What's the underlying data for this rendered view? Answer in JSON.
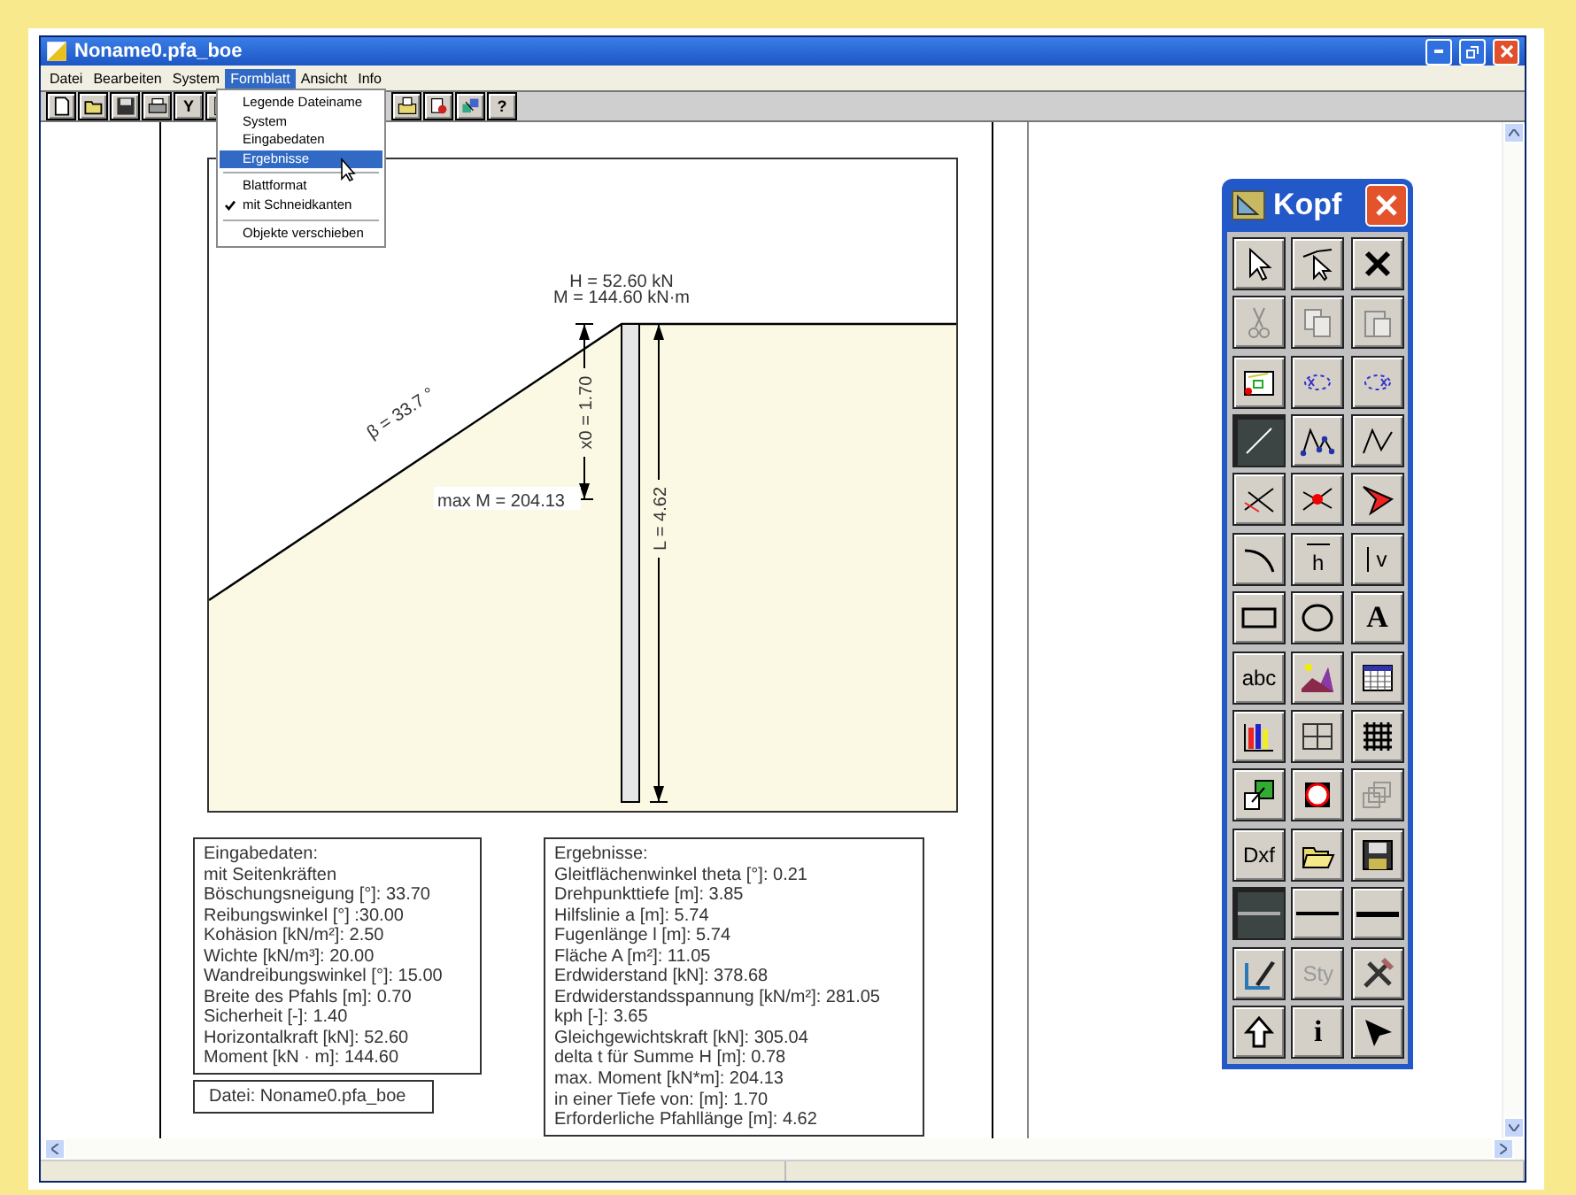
{
  "window": {
    "title": "Noname0.pfa_boe"
  },
  "menu": [
    {
      "label": "Datei",
      "selected": false
    },
    {
      "label": "Bearbeiten",
      "selected": false
    },
    {
      "label": "System",
      "selected": false
    },
    {
      "label": "Formblatt",
      "selected": true
    },
    {
      "label": "Ansicht",
      "selected": false
    },
    {
      "label": "Info",
      "selected": false
    }
  ],
  "dropdown": [
    {
      "kind": "item",
      "label": "Legende Dateiname",
      "checked": false,
      "selected": false
    },
    {
      "kind": "item",
      "label": "System",
      "checked": false,
      "selected": false
    },
    {
      "kind": "item",
      "label": "Eingabedaten",
      "checked": false,
      "selected": false
    },
    {
      "kind": "item",
      "label": "Ergebnisse",
      "checked": false,
      "selected": true
    },
    {
      "kind": "separator"
    },
    {
      "kind": "item",
      "label": "Blattformat",
      "checked": false,
      "selected": false
    },
    {
      "kind": "item",
      "label": "mit Schneidkanten",
      "checked": true,
      "selected": false
    },
    {
      "kind": "separator"
    },
    {
      "kind": "item",
      "label": "Objekte verschieben",
      "checked": false,
      "selected": false
    }
  ],
  "toolbar": {
    "left": [
      {
        "kind": "icon"
      },
      {
        "kind": "icon"
      },
      {
        "kind": "icon"
      },
      {
        "kind": "icon"
      },
      {
        "kind": "text",
        "label": "Y"
      },
      {
        "kind": "icon"
      }
    ],
    "right": [
      {
        "kind": "icon"
      },
      {
        "kind": "icon"
      },
      {
        "kind": "icon"
      },
      {
        "kind": "text",
        "label": "?"
      }
    ]
  },
  "diagram": {
    "force": "H = 52.60 kN",
    "moment": "M = 144.60 kN·m",
    "angle": "β = 33.7 °",
    "x0": "x0 = 1.70",
    "max_moment": "max M = 204.13",
    "length": "L = 4.62"
  },
  "input_box": {
    "lines": [
      "Eingabedaten:",
      "mit Seitenkräften",
      "Böschungsneigung [°]: 33.70",
      "Reibungswinkel [°] :30.00",
      "Kohäsion [kN/m²]: 2.50",
      "Wichte [kN/m³]: 20.00",
      "Wandreibungswinkel [°]: 15.00",
      "Breite des Pfahls [m]: 0.70",
      "Sicherheit [-]: 1.40",
      "Horizontalkraft [kN]: 52.60",
      "Moment [kN · m]: 144.60"
    ]
  },
  "file_box": {
    "text": "Datei: Noname0.pfa_boe"
  },
  "results_box": {
    "lines": [
      "Ergebnisse:",
      "Gleitflächenwinkel theta [°]: 0.21",
      "Drehpunkttiefe [m]: 3.85",
      "Hilfslinie a [m]: 5.74",
      "Fugenlänge l [m]: 5.74",
      "Fläche A [m²]: 11.05",
      "Erdwiderstand [kN]: 378.68",
      "Erdwiderstandsspannung [kN/m²]: 281.05",
      "kph [-]: 3.65",
      "Gleichgewichtskraft [kN]: 305.04",
      "delta t für Summe H [m]: 0.78",
      "max. Moment [kN*m]: 204.13",
      "in einer Tiefe von: [m]: 1.70",
      "Erforderliche Pfahllänge [m]: 4.62"
    ]
  },
  "palette": {
    "title": "Kopf",
    "buttons": [
      {
        "kind": "icon",
        "disabled": false,
        "pressed": false
      },
      {
        "kind": "icon",
        "disabled": false,
        "pressed": false
      },
      {
        "kind": "icon",
        "disabled": false,
        "pressed": false
      },
      {
        "kind": "icon",
        "disabled": true,
        "pressed": false
      },
      {
        "kind": "icon",
        "disabled": true,
        "pressed": false
      },
      {
        "kind": "icon",
        "disabled": true,
        "pressed": false
      },
      {
        "kind": "icon",
        "disabled": false,
        "pressed": false
      },
      {
        "kind": "icon",
        "disabled": false,
        "pressed": false
      },
      {
        "kind": "icon",
        "disabled": false,
        "pressed": false
      },
      {
        "kind": "icon",
        "disabled": false,
        "pressed": true
      },
      {
        "kind": "icon",
        "disabled": false,
        "pressed": false
      },
      {
        "kind": "icon",
        "disabled": false,
        "pressed": false
      },
      {
        "kind": "icon",
        "disabled": false,
        "pressed": false
      },
      {
        "kind": "icon",
        "disabled": false,
        "pressed": false
      },
      {
        "kind": "icon",
        "disabled": false,
        "pressed": false
      },
      {
        "kind": "icon",
        "disabled": false,
        "pressed": false
      },
      {
        "kind": "overline",
        "label": "h",
        "disabled": false,
        "pressed": false
      },
      {
        "kind": "sideline",
        "label": "v",
        "disabled": false,
        "pressed": false
      },
      {
        "kind": "icon",
        "disabled": false,
        "pressed": false
      },
      {
        "kind": "icon",
        "disabled": false,
        "pressed": false
      },
      {
        "kind": "serif",
        "label": "A",
        "disabled": false,
        "pressed": false
      },
      {
        "kind": "text",
        "label": "abc",
        "disabled": false,
        "pressed": false
      },
      {
        "kind": "icon",
        "disabled": false,
        "pressed": false
      },
      {
        "kind": "icon",
        "disabled": false,
        "pressed": false
      },
      {
        "kind": "icon",
        "disabled": false,
        "pressed": false
      },
      {
        "kind": "icon",
        "disabled": false,
        "pressed": false
      },
      {
        "kind": "icon",
        "disabled": false,
        "pressed": false
      },
      {
        "kind": "icon",
        "disabled": false,
        "pressed": false
      },
      {
        "kind": "icon",
        "disabled": false,
        "pressed": false
      },
      {
        "kind": "icon",
        "disabled": true,
        "pressed": false
      },
      {
        "kind": "text",
        "label": "Dxf",
        "disabled": false,
        "pressed": false
      },
      {
        "kind": "icon",
        "disabled": false,
        "pressed": false
      },
      {
        "kind": "icon",
        "disabled": false,
        "pressed": false
      },
      {
        "kind": "icon",
        "disabled": false,
        "pressed": true
      },
      {
        "kind": "icon",
        "disabled": false,
        "pressed": false
      },
      {
        "kind": "icon",
        "disabled": false,
        "pressed": false
      },
      {
        "kind": "icon",
        "disabled": false,
        "pressed": false
      },
      {
        "kind": "text",
        "label": "Sty",
        "disabled": true,
        "pressed": false
      },
      {
        "kind": "icon",
        "disabled": false,
        "pressed": false
      },
      {
        "kind": "icon",
        "disabled": false,
        "pressed": false
      },
      {
        "kind": "serif",
        "label": "i",
        "disabled": false,
        "pressed": false
      },
      {
        "kind": "icon",
        "disabled": false,
        "pressed": false
      }
    ]
  }
}
